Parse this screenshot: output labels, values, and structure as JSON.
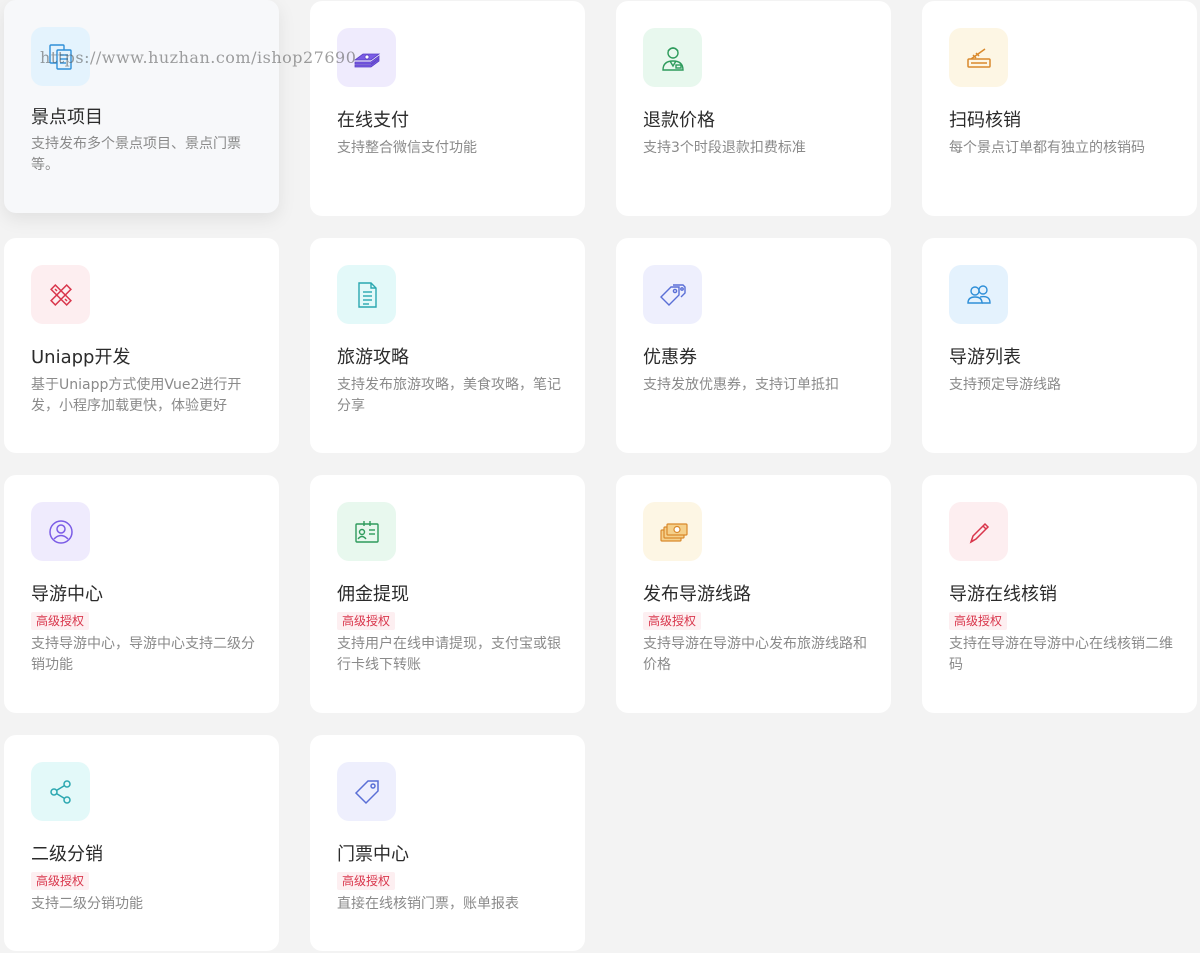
{
  "watermark": "https://www.huzhan.com/ishop27690",
  "badge_label": "高级授权",
  "cards": [
    {
      "title": "景点项目",
      "desc": "支持发布多个景点项目、景点门票等。",
      "icon": "documents-icon",
      "badge": false
    },
    {
      "title": "在线支付",
      "desc": "支持整合微信支付功能",
      "icon": "cash-stack-icon",
      "badge": false
    },
    {
      "title": "退款价格",
      "desc": "支持3个时段退款扣费标准",
      "icon": "service-person-icon",
      "badge": false
    },
    {
      "title": "扫码核销",
      "desc": "每个景点订单都有独立的核销码",
      "icon": "scanner-icon",
      "badge": false
    },
    {
      "title": "Uniapp开发",
      "desc": "基于Uniapp方式使用Vue2进行开发，小程序加载更快，体验更好",
      "icon": "pencil-ruler-icon",
      "badge": false
    },
    {
      "title": "旅游攻略",
      "desc": "支持发布旅游攻略，美食攻略，笔记分享",
      "icon": "document-lines-icon",
      "badge": false
    },
    {
      "title": "优惠券",
      "desc": "支持发放优惠券，支持订单抵扣",
      "icon": "tags-icon",
      "badge": false
    },
    {
      "title": "导游列表",
      "desc": "支持预定导游线路",
      "icon": "users-icon",
      "badge": false
    },
    {
      "title": "导游中心",
      "desc": "支持导游中心，导游中心支持二级分销功能",
      "icon": "user-circle-icon",
      "badge": true
    },
    {
      "title": "佣金提现",
      "desc": "支持用户在线申请提现，支付宝或银行卡线下转账",
      "icon": "id-card-icon",
      "badge": true
    },
    {
      "title": "发布导游线路",
      "desc": "支持导游在导游中心发布旅游线路和价格",
      "icon": "money-icon",
      "badge": true
    },
    {
      "title": "导游在线核销",
      "desc": "支持在导游在导游中心在线核销二维码",
      "icon": "pen-icon",
      "badge": true
    },
    {
      "title": "二级分销",
      "desc": "支持二级分销功能",
      "icon": "share-icon",
      "badge": true
    },
    {
      "title": "门票中心",
      "desc": "直接在线核销门票，账单报表",
      "icon": "tag-icon",
      "badge": true
    }
  ],
  "colors": {
    "background": "#f3f3f3",
    "card": "#ffffff",
    "badge_text": "#d9364c",
    "badge_bg": "#fdeff1"
  }
}
